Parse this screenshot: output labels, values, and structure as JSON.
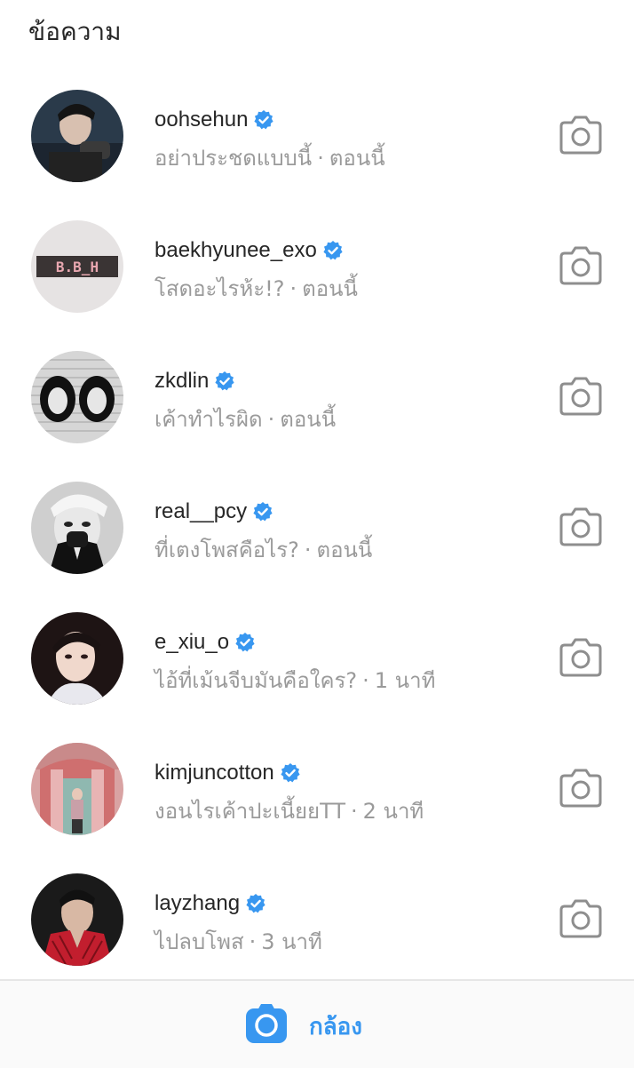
{
  "header": {
    "title": "ข้อความ"
  },
  "threads": [
    {
      "username": "oohsehun",
      "message": "อย่าประชดแบบนี้",
      "time": "ตอนนี้",
      "avatar": "avatar-photo"
    },
    {
      "username": "baekhyunee_exo",
      "message": "โสดอะไรห้ะ!?",
      "time": "ตอนนี้",
      "avatar": "avatar-bbh-logo",
      "avatar_text": "B.B_H"
    },
    {
      "username": "zkdlin",
      "message": "เค้าทำไรผิด",
      "time": "ตอนนี้",
      "avatar": "avatar-eyes-graphic"
    },
    {
      "username": "real__pcy",
      "message": "ที่เตงโพสคือไร?",
      "time": "ตอนนี้",
      "avatar": "avatar-photo"
    },
    {
      "username": "e_xiu_o",
      "message": "ไอ้ที่เม้นจีบมันคือใคร?",
      "time": "1 นาที",
      "avatar": "avatar-photo"
    },
    {
      "username": "kimjuncotton",
      "message": "งอนไรเค้าปะเนี้ยยTT",
      "time": "2 นาที",
      "avatar": "avatar-photo"
    },
    {
      "username": "layzhang",
      "message": "ไปลบโพส",
      "time": "3 นาที",
      "avatar": "avatar-photo"
    }
  ],
  "separator": "·",
  "bottom_bar": {
    "camera_label": "กล้อง",
    "icon": "camera-icon"
  },
  "colors": {
    "accent": "#3897f0",
    "verified": "#3897f0",
    "muted": "#9a9a9a",
    "text": "#262626"
  }
}
